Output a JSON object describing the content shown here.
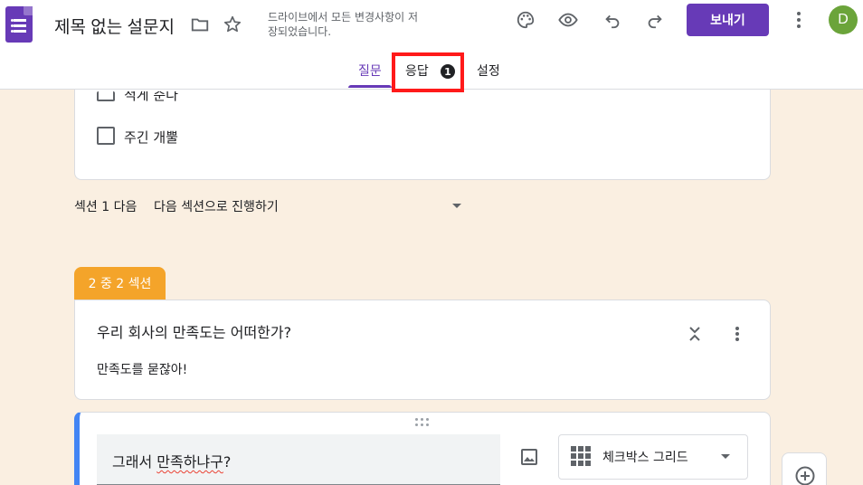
{
  "header": {
    "title": "제목 없는 설문지",
    "save_status": "드라이브에서 모든 변경사항이 저장되었습니다.",
    "send_label": "보내기",
    "avatar_letter": "D",
    "icons": [
      "folder-icon",
      "star-icon",
      "palette-icon",
      "eye-icon",
      "undo-icon",
      "redo-icon",
      "more-vert-icon"
    ]
  },
  "tabs": {
    "questions": "질문",
    "responses": "응답",
    "responses_badge": "1",
    "settings": "설정"
  },
  "section1": {
    "options": [
      "적게 준다",
      "주긴 개뿔"
    ],
    "after_label": "섹션 1 다음",
    "after_value": "다음 섹션으로 진행하기"
  },
  "section2": {
    "tag": "2 중 2 섹션",
    "title": "우리 회사의 만족도는 어떠한가?",
    "description": "만족도를 묻잖아!"
  },
  "question": {
    "text_before": "그래서 ",
    "text_spell": "만족하냐구",
    "text_after": "?",
    "type_label": "체크박스 그리드"
  },
  "colors": {
    "accent": "#673ab7",
    "background": "#faefe1",
    "section_tag": "#f4a42a",
    "highlight": "#ff1a1a",
    "active_question": "#4285f4"
  }
}
